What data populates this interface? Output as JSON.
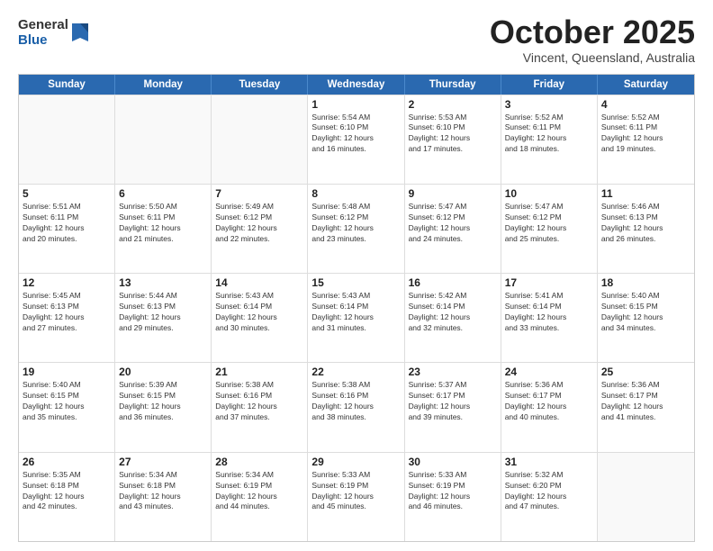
{
  "logo": {
    "general": "General",
    "blue": "Blue"
  },
  "header": {
    "month": "October 2025",
    "location": "Vincent, Queensland, Australia"
  },
  "weekdays": [
    "Sunday",
    "Monday",
    "Tuesday",
    "Wednesday",
    "Thursday",
    "Friday",
    "Saturday"
  ],
  "rows": [
    [
      {
        "day": "",
        "info": ""
      },
      {
        "day": "",
        "info": ""
      },
      {
        "day": "",
        "info": ""
      },
      {
        "day": "1",
        "info": "Sunrise: 5:54 AM\nSunset: 6:10 PM\nDaylight: 12 hours\nand 16 minutes."
      },
      {
        "day": "2",
        "info": "Sunrise: 5:53 AM\nSunset: 6:10 PM\nDaylight: 12 hours\nand 17 minutes."
      },
      {
        "day": "3",
        "info": "Sunrise: 5:52 AM\nSunset: 6:11 PM\nDaylight: 12 hours\nand 18 minutes."
      },
      {
        "day": "4",
        "info": "Sunrise: 5:52 AM\nSunset: 6:11 PM\nDaylight: 12 hours\nand 19 minutes."
      }
    ],
    [
      {
        "day": "5",
        "info": "Sunrise: 5:51 AM\nSunset: 6:11 PM\nDaylight: 12 hours\nand 20 minutes."
      },
      {
        "day": "6",
        "info": "Sunrise: 5:50 AM\nSunset: 6:11 PM\nDaylight: 12 hours\nand 21 minutes."
      },
      {
        "day": "7",
        "info": "Sunrise: 5:49 AM\nSunset: 6:12 PM\nDaylight: 12 hours\nand 22 minutes."
      },
      {
        "day": "8",
        "info": "Sunrise: 5:48 AM\nSunset: 6:12 PM\nDaylight: 12 hours\nand 23 minutes."
      },
      {
        "day": "9",
        "info": "Sunrise: 5:47 AM\nSunset: 6:12 PM\nDaylight: 12 hours\nand 24 minutes."
      },
      {
        "day": "10",
        "info": "Sunrise: 5:47 AM\nSunset: 6:12 PM\nDaylight: 12 hours\nand 25 minutes."
      },
      {
        "day": "11",
        "info": "Sunrise: 5:46 AM\nSunset: 6:13 PM\nDaylight: 12 hours\nand 26 minutes."
      }
    ],
    [
      {
        "day": "12",
        "info": "Sunrise: 5:45 AM\nSunset: 6:13 PM\nDaylight: 12 hours\nand 27 minutes."
      },
      {
        "day": "13",
        "info": "Sunrise: 5:44 AM\nSunset: 6:13 PM\nDaylight: 12 hours\nand 29 minutes."
      },
      {
        "day": "14",
        "info": "Sunrise: 5:43 AM\nSunset: 6:14 PM\nDaylight: 12 hours\nand 30 minutes."
      },
      {
        "day": "15",
        "info": "Sunrise: 5:43 AM\nSunset: 6:14 PM\nDaylight: 12 hours\nand 31 minutes."
      },
      {
        "day": "16",
        "info": "Sunrise: 5:42 AM\nSunset: 6:14 PM\nDaylight: 12 hours\nand 32 minutes."
      },
      {
        "day": "17",
        "info": "Sunrise: 5:41 AM\nSunset: 6:14 PM\nDaylight: 12 hours\nand 33 minutes."
      },
      {
        "day": "18",
        "info": "Sunrise: 5:40 AM\nSunset: 6:15 PM\nDaylight: 12 hours\nand 34 minutes."
      }
    ],
    [
      {
        "day": "19",
        "info": "Sunrise: 5:40 AM\nSunset: 6:15 PM\nDaylight: 12 hours\nand 35 minutes."
      },
      {
        "day": "20",
        "info": "Sunrise: 5:39 AM\nSunset: 6:15 PM\nDaylight: 12 hours\nand 36 minutes."
      },
      {
        "day": "21",
        "info": "Sunrise: 5:38 AM\nSunset: 6:16 PM\nDaylight: 12 hours\nand 37 minutes."
      },
      {
        "day": "22",
        "info": "Sunrise: 5:38 AM\nSunset: 6:16 PM\nDaylight: 12 hours\nand 38 minutes."
      },
      {
        "day": "23",
        "info": "Sunrise: 5:37 AM\nSunset: 6:17 PM\nDaylight: 12 hours\nand 39 minutes."
      },
      {
        "day": "24",
        "info": "Sunrise: 5:36 AM\nSunset: 6:17 PM\nDaylight: 12 hours\nand 40 minutes."
      },
      {
        "day": "25",
        "info": "Sunrise: 5:36 AM\nSunset: 6:17 PM\nDaylight: 12 hours\nand 41 minutes."
      }
    ],
    [
      {
        "day": "26",
        "info": "Sunrise: 5:35 AM\nSunset: 6:18 PM\nDaylight: 12 hours\nand 42 minutes."
      },
      {
        "day": "27",
        "info": "Sunrise: 5:34 AM\nSunset: 6:18 PM\nDaylight: 12 hours\nand 43 minutes."
      },
      {
        "day": "28",
        "info": "Sunrise: 5:34 AM\nSunset: 6:19 PM\nDaylight: 12 hours\nand 44 minutes."
      },
      {
        "day": "29",
        "info": "Sunrise: 5:33 AM\nSunset: 6:19 PM\nDaylight: 12 hours\nand 45 minutes."
      },
      {
        "day": "30",
        "info": "Sunrise: 5:33 AM\nSunset: 6:19 PM\nDaylight: 12 hours\nand 46 minutes."
      },
      {
        "day": "31",
        "info": "Sunrise: 5:32 AM\nSunset: 6:20 PM\nDaylight: 12 hours\nand 47 minutes."
      },
      {
        "day": "",
        "info": ""
      }
    ]
  ]
}
